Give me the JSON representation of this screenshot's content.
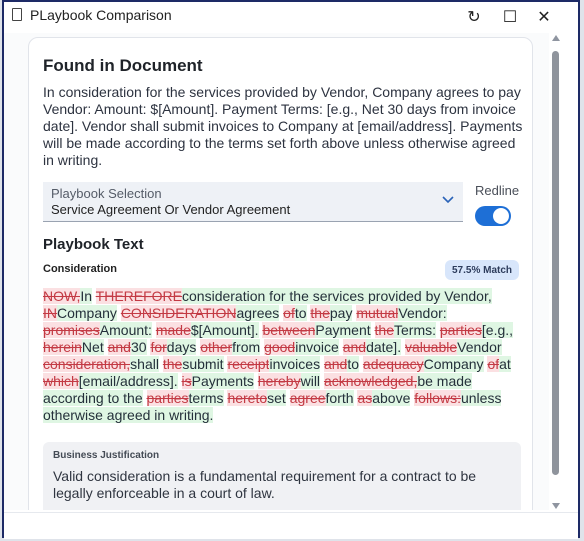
{
  "window": {
    "title": "PLaybook Comparison",
    "controls": {
      "refresh": "↻",
      "maximize": "☐",
      "close": "✕"
    }
  },
  "found": {
    "heading": "Found in Document",
    "text": "In consideration for the services provided by Vendor, Company agrees to pay Vendor: Amount: $[Amount]. Payment Terms: [e.g., Net 30 days from invoice date]. Vendor shall submit invoices to Company at [email/address]. Payments will be made according to the terms set forth above unless otherwise agreed in writing."
  },
  "playbook_select": {
    "label": "Playbook Selection",
    "value": "Service Agreement Or Vendor Agreement"
  },
  "redline_toggle": {
    "label": "Redline",
    "on": true
  },
  "playbook_text": {
    "heading": "Playbook Text",
    "section": "Consideration",
    "match": "57.5% Match",
    "segments": [
      {
        "t": "del",
        "s": "NOW,"
      },
      {
        "t": "ins",
        "s": "In"
      },
      {
        "t": "eq",
        "s": " "
      },
      {
        "t": "del",
        "s": "THEREFORE"
      },
      {
        "t": "ins",
        "s": "consideration for the services provided by Vendor,"
      },
      {
        "t": "eq",
        "s": " "
      },
      {
        "t": "del",
        "s": "IN"
      },
      {
        "t": "ins",
        "s": "Company"
      },
      {
        "t": "eq",
        "s": " "
      },
      {
        "t": "del",
        "s": "CONSIDERATION"
      },
      {
        "t": "ins",
        "s": "agrees"
      },
      {
        "t": "eq",
        "s": " "
      },
      {
        "t": "del",
        "s": "of"
      },
      {
        "t": "ins",
        "s": "to"
      },
      {
        "t": "eq",
        "s": " "
      },
      {
        "t": "del",
        "s": "the"
      },
      {
        "t": "ins",
        "s": "pay"
      },
      {
        "t": "eq",
        "s": " "
      },
      {
        "t": "del",
        "s": "mutual"
      },
      {
        "t": "ins",
        "s": "Vendor:"
      },
      {
        "t": "eq",
        "s": " "
      },
      {
        "t": "del",
        "s": "promises"
      },
      {
        "t": "ins",
        "s": "Amount:"
      },
      {
        "t": "eq",
        "s": " "
      },
      {
        "t": "del",
        "s": "made"
      },
      {
        "t": "ins",
        "s": "$[Amount]."
      },
      {
        "t": "eq",
        "s": " "
      },
      {
        "t": "del",
        "s": "between"
      },
      {
        "t": "ins",
        "s": "Payment"
      },
      {
        "t": "eq",
        "s": " "
      },
      {
        "t": "del",
        "s": "the"
      },
      {
        "t": "ins",
        "s": "Terms:"
      },
      {
        "t": "eq",
        "s": " "
      },
      {
        "t": "del",
        "s": "parties"
      },
      {
        "t": "ins",
        "s": "[e.g.,"
      },
      {
        "t": "eq",
        "s": " "
      },
      {
        "t": "del",
        "s": "herein"
      },
      {
        "t": "ins",
        "s": "Net"
      },
      {
        "t": "eq",
        "s": " "
      },
      {
        "t": "del",
        "s": "and"
      },
      {
        "t": "ins",
        "s": "30"
      },
      {
        "t": "eq",
        "s": " "
      },
      {
        "t": "del",
        "s": "for"
      },
      {
        "t": "ins",
        "s": "days"
      },
      {
        "t": "eq",
        "s": " "
      },
      {
        "t": "del",
        "s": "other"
      },
      {
        "t": "ins",
        "s": "from"
      },
      {
        "t": "eq",
        "s": " "
      },
      {
        "t": "del",
        "s": "good"
      },
      {
        "t": "ins",
        "s": "invoice"
      },
      {
        "t": "eq",
        "s": " "
      },
      {
        "t": "del",
        "s": "and"
      },
      {
        "t": "ins",
        "s": "date]."
      },
      {
        "t": "eq",
        "s": " "
      },
      {
        "t": "del",
        "s": "valuable"
      },
      {
        "t": "ins",
        "s": "Vendor"
      },
      {
        "t": "eq",
        "s": " "
      },
      {
        "t": "del",
        "s": "consideration,"
      },
      {
        "t": "ins",
        "s": "shall"
      },
      {
        "t": "eq",
        "s": " "
      },
      {
        "t": "del",
        "s": "the"
      },
      {
        "t": "ins",
        "s": "submit"
      },
      {
        "t": "eq",
        "s": " "
      },
      {
        "t": "del",
        "s": "receipt"
      },
      {
        "t": "ins",
        "s": "invoices"
      },
      {
        "t": "eq",
        "s": " "
      },
      {
        "t": "del",
        "s": "and"
      },
      {
        "t": "ins",
        "s": "to"
      },
      {
        "t": "eq",
        "s": " "
      },
      {
        "t": "del",
        "s": "adequacy"
      },
      {
        "t": "ins",
        "s": "Company"
      },
      {
        "t": "eq",
        "s": " "
      },
      {
        "t": "del",
        "s": "of"
      },
      {
        "t": "ins",
        "s": "at"
      },
      {
        "t": "eq",
        "s": " "
      },
      {
        "t": "del",
        "s": "which"
      },
      {
        "t": "ins",
        "s": "[email/address]."
      },
      {
        "t": "eq",
        "s": " "
      },
      {
        "t": "del",
        "s": "is"
      },
      {
        "t": "ins",
        "s": "Payments"
      },
      {
        "t": "eq",
        "s": " "
      },
      {
        "t": "del",
        "s": "hereby"
      },
      {
        "t": "ins",
        "s": "will"
      },
      {
        "t": "eq",
        "s": " "
      },
      {
        "t": "del",
        "s": "acknowledged,"
      },
      {
        "t": "ins",
        "s": "be made according to the"
      },
      {
        "t": "eq",
        "s": " "
      },
      {
        "t": "del",
        "s": "parties"
      },
      {
        "t": "ins",
        "s": "terms"
      },
      {
        "t": "eq",
        "s": " "
      },
      {
        "t": "del",
        "s": "hereto"
      },
      {
        "t": "ins",
        "s": "set"
      },
      {
        "t": "eq",
        "s": " "
      },
      {
        "t": "del",
        "s": "agree"
      },
      {
        "t": "ins",
        "s": "forth"
      },
      {
        "t": "eq",
        "s": " "
      },
      {
        "t": "del",
        "s": "as"
      },
      {
        "t": "ins",
        "s": "above"
      },
      {
        "t": "eq",
        "s": " "
      },
      {
        "t": "del",
        "s": "follows:"
      },
      {
        "t": "ins",
        "s": "unless otherwise agreed in writing."
      }
    ]
  },
  "justification": {
    "label": "Business Justification",
    "text": "Valid consideration is a fundamental requirement for a contract to be legally enforceable in a court of law."
  },
  "colors": {
    "accent": "#1e6fd6",
    "deleted": "#c33a44",
    "deleted_bg": "#fbe0e2",
    "inserted_bg": "#dff6e3",
    "border": "#1d2a66"
  }
}
